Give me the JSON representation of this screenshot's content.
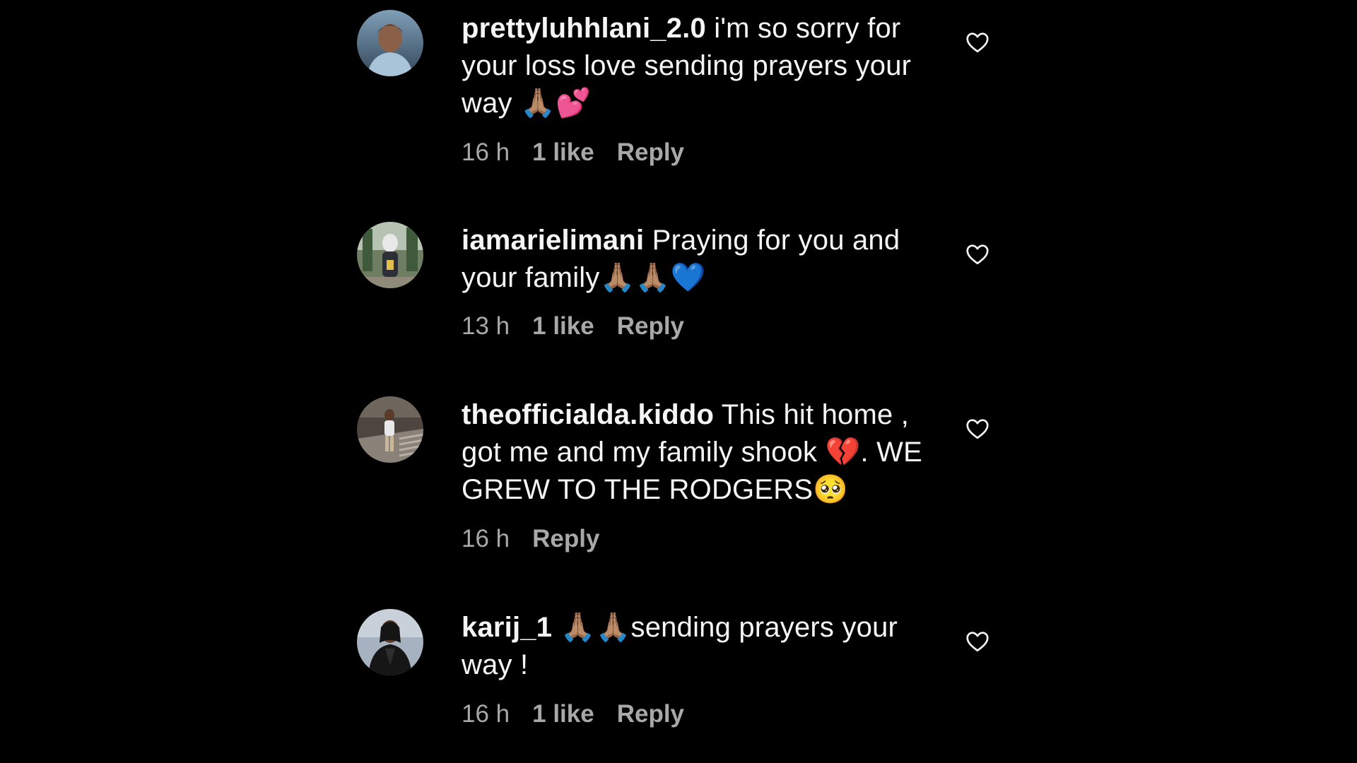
{
  "comments": [
    {
      "username": "prettyluhhlani_2.0",
      "text": "i'm so sorry for your loss love sending prayers your way 🙏🏽💕",
      "time": "16 h",
      "likes": "1 like",
      "reply": "Reply",
      "avatar_colors": [
        "#6b8ca8",
        "#3c5066"
      ]
    },
    {
      "username": "iamarielimani",
      "text": "Praying for you and your family🙏🏽🙏🏽💙",
      "time": "13 h",
      "likes": "1 like",
      "reply": "Reply",
      "avatar_colors": [
        "#8e9a7a",
        "#4a5644"
      ]
    },
    {
      "username": "theofficialda.kiddo",
      "text": "This hit home , got me and my family shook 💔. WE GREW TO THE RODGERS🥺",
      "time": "16 h",
      "likes": "",
      "reply": "Reply",
      "avatar_colors": [
        "#7a6f66",
        "#3a3430"
      ]
    },
    {
      "username": "karij_1",
      "text": "🙏🏽🙏🏽sending prayers your way !",
      "time": "16 h",
      "likes": "1 like",
      "reply": "Reply",
      "avatar_colors": [
        "#9aa6b4",
        "#1e2228"
      ]
    }
  ],
  "icons": {
    "like": "heart-outline-icon"
  }
}
